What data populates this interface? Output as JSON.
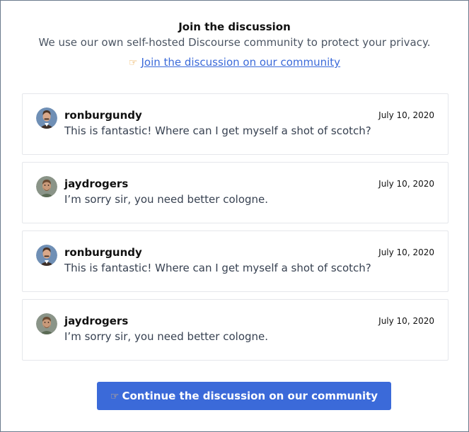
{
  "header": {
    "title": "Join the discussion",
    "subtitle": "We use our own self-hosted Discourse community to protect your privacy.",
    "pointer_icon": "pointing-hand-icon",
    "join_link": "Join the discussion on our community"
  },
  "comments": [
    {
      "username": "ronburgundy",
      "message": "This is fantastic! Where can I get myself a shot of scotch?",
      "date": "July 10, 2020",
      "avatar_icon": "avatar-ronburgundy"
    },
    {
      "username": "jaydrogers",
      "message": "I’m sorry sir, you need better cologne.",
      "date": "July 10, 2020",
      "avatar_icon": "avatar-jaydrogers"
    },
    {
      "username": "ronburgundy",
      "message": "This is fantastic! Where can I get myself a shot of scotch?",
      "date": "July 10, 2020",
      "avatar_icon": "avatar-ronburgundy"
    },
    {
      "username": "jaydrogers",
      "message": "I’m sorry sir, you need better cologne.",
      "date": "July 10, 2020",
      "avatar_icon": "avatar-jaydrogers"
    }
  ],
  "cta": {
    "label": "Continue  the discussion on our community",
    "pointer_icon": "pointing-hand-icon"
  },
  "colors": {
    "accent": "#3b6ad9",
    "border": "#e5e7eb",
    "frame": "#6b7a8d"
  }
}
